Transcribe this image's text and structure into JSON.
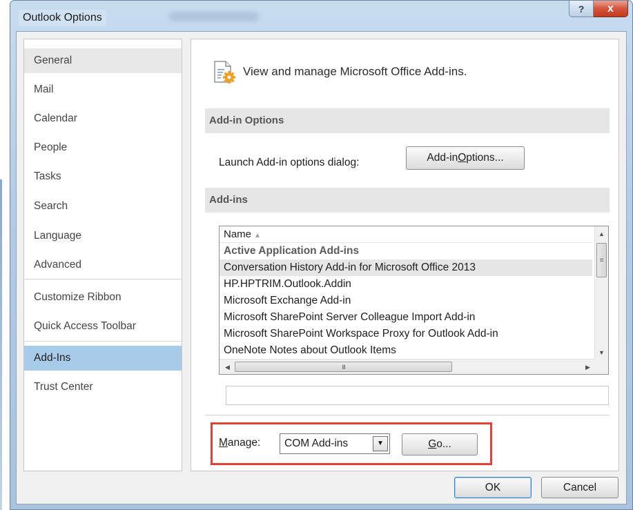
{
  "window": {
    "title": "Outlook Options",
    "help_label": "?",
    "close_label": "x"
  },
  "nav": {
    "items": [
      {
        "label": "General"
      },
      {
        "label": "Mail"
      },
      {
        "label": "Calendar"
      },
      {
        "label": "People"
      },
      {
        "label": "Tasks"
      },
      {
        "label": "Search"
      },
      {
        "label": "Language"
      },
      {
        "label": "Advanced"
      },
      {
        "label": "Customize Ribbon"
      },
      {
        "label": "Quick Access Toolbar"
      },
      {
        "label": "Add-Ins"
      },
      {
        "label": "Trust Center"
      }
    ],
    "selected": "Add-Ins"
  },
  "main": {
    "header_icon": "addins-gear-document-icon",
    "header_text": "View and manage Microsoft Office Add-ins.",
    "addin_options_section": "Add-in Options",
    "launch_label": "Launch Add-in options dialog:",
    "addin_options_button": {
      "pre": "Add-in ",
      "accel": "O",
      "post": "ptions..."
    },
    "addins_section": "Add-ins",
    "list": {
      "column_name": "Name",
      "sort_icon": "sort-ascending-icon",
      "group": "Active Application Add-ins",
      "rows": [
        "Conversation History Add-in for Microsoft Office 2013",
        "HP.HPTRIM.Outlook.Addin",
        "Microsoft Exchange Add-in",
        "Microsoft SharePoint Server Colleague Import Add-in",
        "Microsoft SharePoint Workspace Proxy for Outlook Add-in",
        "OneNote Notes about Outlook Items"
      ],
      "selected_index": 0,
      "hscroll_grip": "III"
    },
    "manage": {
      "label_accel": "M",
      "label_post": "anage:",
      "value": "COM Add-ins",
      "go_accel": "G",
      "go_post": "o..."
    }
  },
  "footer": {
    "ok_label": "OK",
    "cancel_label": "Cancel"
  },
  "colors": {
    "selection": "#a8cbe9",
    "highlight_border": "#e2413a",
    "window_frame": "#b4cce6"
  }
}
